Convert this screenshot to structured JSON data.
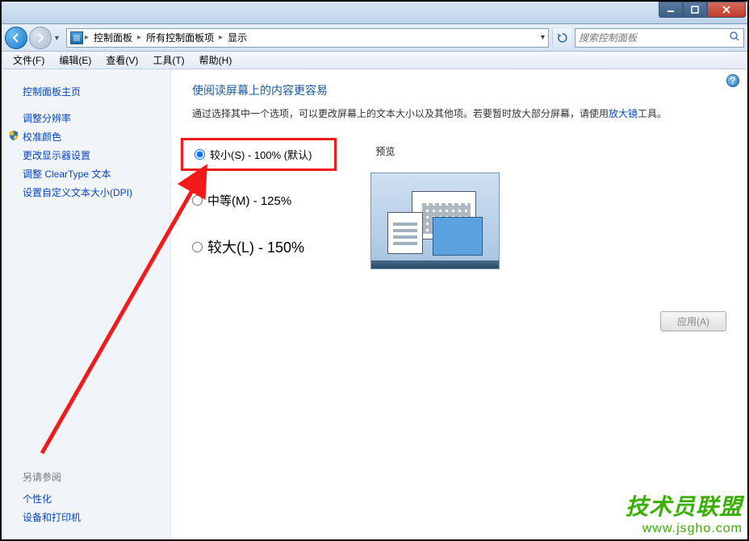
{
  "titlebar": {
    "minimize": "minimize",
    "maximize": "maximize",
    "close": "close"
  },
  "breadcrumb": {
    "items": [
      "控制面板",
      "所有控制面板项",
      "显示"
    ]
  },
  "search": {
    "placeholder": "搜索控制面板"
  },
  "menubar": {
    "items": [
      "文件(F)",
      "编辑(E)",
      "查看(V)",
      "工具(T)",
      "帮助(H)"
    ]
  },
  "sidebar": {
    "home": "控制面板主页",
    "items": [
      {
        "label": "调整分辨率",
        "shield": false
      },
      {
        "label": "校准颜色",
        "shield": true
      },
      {
        "label": "更改显示器设置",
        "shield": false
      },
      {
        "label": "调整 ClearType 文本",
        "shield": false
      },
      {
        "label": "设置自定义文本大小(DPI)",
        "shield": false
      }
    ],
    "seealso_heading": "另请参阅",
    "seealso": [
      "个性化",
      "设备和打印机"
    ]
  },
  "main": {
    "title": "使阅读屏幕上的内容更容易",
    "description_pre": "通过选择其中一个选项，可以更改屏幕上的文本大小以及其他项。若要暂时放大部分屏幕，请使用",
    "magnifier_link": "放大镜",
    "description_post": "工具。",
    "options": [
      {
        "id": "small",
        "label": "较小(S) - 100% (默认)",
        "checked": true,
        "size": "small",
        "highlight": true
      },
      {
        "id": "medium",
        "label": "中等(M) - 125%",
        "checked": false,
        "size": "med"
      },
      {
        "id": "large",
        "label": "较大(L) - 150%",
        "checked": false,
        "size": "large"
      }
    ],
    "preview_label": "预览",
    "apply_label": "应用(A)"
  },
  "watermark": {
    "line1": "技术员联盟",
    "line2": "www.jsgho.com"
  }
}
